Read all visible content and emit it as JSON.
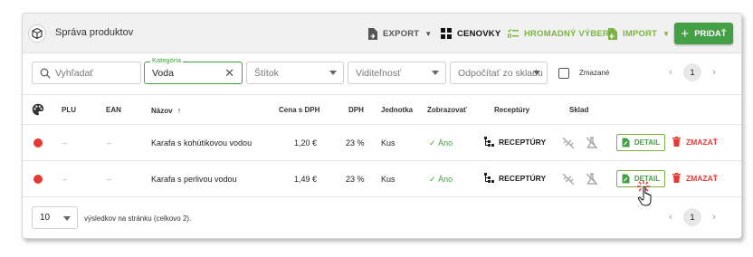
{
  "header": {
    "title": "Správa produktov",
    "export_label": "EXPORT",
    "cenovky_label": "CENOVKY",
    "hromadny_label": "HROMADNÝ VÝBER",
    "import_label": "IMPORT",
    "add_label": "PRIDAŤ"
  },
  "filters": {
    "search_placeholder": "Vyhľadať",
    "category_legend": "Kategória",
    "category_value": "Voda",
    "tag_placeholder": "Štítok",
    "visibility_placeholder": "Viditeľnosť",
    "stock_placeholder": "Odpočítať zo skladu",
    "deleted_label": "Zmazané",
    "page": "1"
  },
  "table": {
    "columns": {
      "plu": "PLU",
      "ean": "EAN",
      "name": "Názov",
      "price": "Cena s DPH",
      "vat": "DPH",
      "unit": "Jednotka",
      "show": "Zobrazovať",
      "recipes": "Receptúry",
      "stock": "Sklad"
    },
    "rows": [
      {
        "color": "#e53935",
        "plu": "–",
        "ean": "–",
        "name": "Karafa s kohútikovou vodou",
        "price": "1,20 €",
        "vat": "23 %",
        "unit": "Kus",
        "show": "Áno",
        "recipes_label": "RECEPTÚRY",
        "detail_label": "DETAIL",
        "delete_label": "ZMAZAŤ"
      },
      {
        "color": "#e53935",
        "plu": "–",
        "ean": "–",
        "name": "Karafa s perlivou vodou",
        "price": "1,49 €",
        "vat": "23 %",
        "unit": "Kus",
        "show": "Áno",
        "recipes_label": "RECEPTÚRY",
        "detail_label": "DETAIL",
        "delete_label": "ZMAZAŤ"
      }
    ]
  },
  "footer": {
    "per_page": "10",
    "results_text": "výsledkov na stránku (celkovo 2).",
    "page": "1"
  },
  "colors": {
    "accent_green": "#43a047",
    "danger_red": "#e53935",
    "light_green": "#7cb342"
  }
}
